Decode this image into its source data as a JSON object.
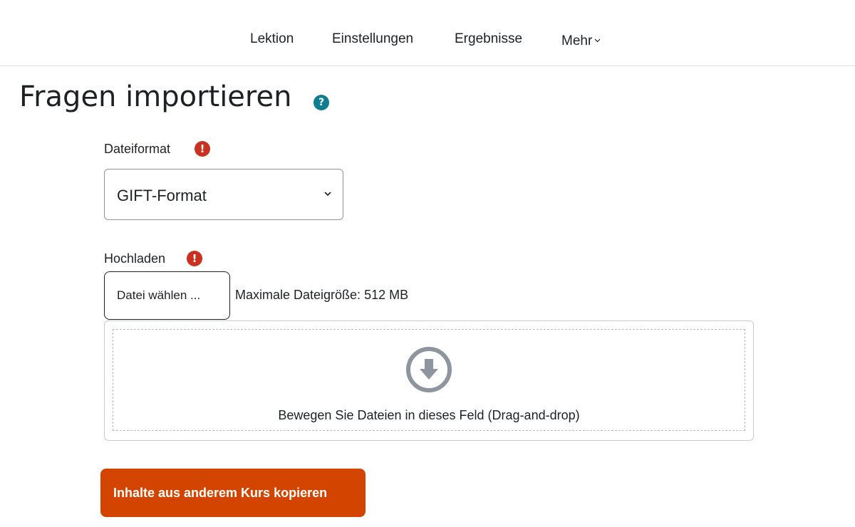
{
  "nav": {
    "items": [
      {
        "label": "Lektion"
      },
      {
        "label": "Einstellungen"
      },
      {
        "label": "Ergebnisse"
      },
      {
        "label": "Mehr"
      }
    ]
  },
  "page": {
    "title": "Fragen importieren",
    "help_glyph": "?"
  },
  "form": {
    "format_label": "Dateiformat",
    "format_value": "GIFT-Format",
    "upload_label": "Hochladen",
    "required_glyph": "!",
    "choose_file_label": "Datei wählen ...",
    "max_size_text": "Maximale Dateigröße: 512 MB",
    "dropzone_text": "Bewegen Sie Dateien in dieses Feld (Drag-and-drop)"
  },
  "actions": {
    "copy_label": "Inhalte aus anderem Kurs kopieren"
  },
  "icons": {
    "help": "question-circle-icon",
    "required": "exclamation-circle-icon",
    "select": "chevron-down-icon",
    "dropzone": "download-arrow-circle-icon"
  },
  "colors": {
    "accent_button": "#d24400",
    "required": "#ca3120",
    "help": "#117d91"
  }
}
